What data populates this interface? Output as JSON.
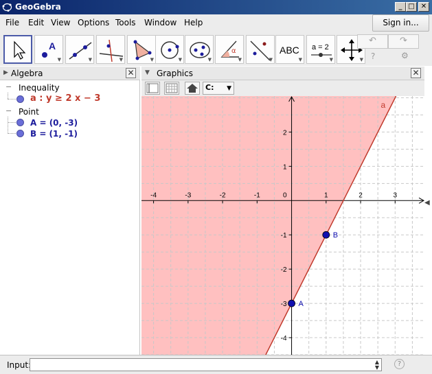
{
  "window": {
    "title": "GeoGebra",
    "app_icon": "geogebra-icon"
  },
  "menubar": {
    "items": [
      "File",
      "Edit",
      "View",
      "Options",
      "Tools",
      "Window",
      "Help"
    ],
    "signin_label": "Sign in..."
  },
  "toolbar": {
    "tools": [
      {
        "icon": "move-arrow-icon"
      },
      {
        "icon": "point-icon",
        "glyph": "A"
      },
      {
        "icon": "line-icon"
      },
      {
        "icon": "perpendicular-line-icon"
      },
      {
        "icon": "polygon-icon"
      },
      {
        "icon": "circle-icon"
      },
      {
        "icon": "conic-icon"
      },
      {
        "icon": "angle-icon",
        "glyph": "α"
      },
      {
        "icon": "reflect-icon"
      },
      {
        "icon": "text-icon",
        "glyph": "ABC"
      },
      {
        "icon": "slider-icon",
        "glyph": "a = 2"
      },
      {
        "icon": "move-view-icon"
      }
    ],
    "undo_icon": "undo-icon",
    "redo_icon": "redo-icon",
    "help_glyph": "?",
    "settings_glyph": "⚙"
  },
  "algebra": {
    "title": "Algebra",
    "categories": [
      {
        "label": "Inequality",
        "objects": [
          {
            "text": "a : y ≥ 2 x − 3",
            "color": "#c0392b"
          }
        ]
      },
      {
        "label": "Point",
        "objects": [
          {
            "text": "A = (0, -3)",
            "color": "#1c1c9c"
          },
          {
            "text": "B = (1, -1)",
            "color": "#1c1c9c"
          }
        ]
      }
    ]
  },
  "graphics": {
    "title": "Graphics",
    "style_button_label": "C:"
  },
  "chart_data": {
    "type": "line",
    "title": "",
    "xlabel": "",
    "ylabel": "",
    "xlim": [
      -4.35,
      3.85
    ],
    "ylim": [
      -4.5,
      3.05
    ],
    "x_ticks": [
      -4,
      -3,
      -2,
      -1,
      1,
      2,
      3
    ],
    "y_ticks": [
      -4,
      -3,
      -2,
      -1,
      1,
      2
    ],
    "origin_label": "0",
    "grid": true,
    "inequality": {
      "label": "a",
      "slope": 2,
      "intercept": -3,
      "shade": "above",
      "fill": "#ffc0c0",
      "line_color": "#c0392b"
    },
    "points": [
      {
        "label": "A",
        "x": 0,
        "y": -3
      },
      {
        "label": "B",
        "x": 1,
        "y": -1
      }
    ],
    "point_color": "#1010b0"
  },
  "inputbar": {
    "label": "Input:",
    "value": "",
    "help_glyph": "?"
  }
}
